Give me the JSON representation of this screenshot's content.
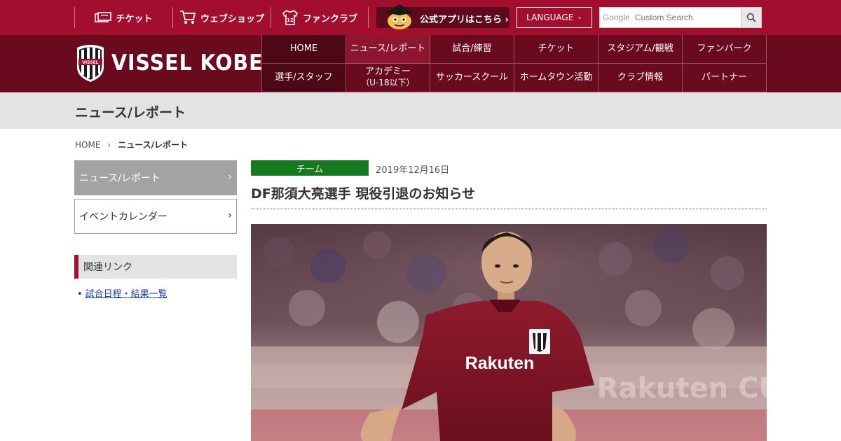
{
  "colors": {
    "brand": "#a30d2e",
    "header_dark": "#6a0a1e",
    "category_green": "#137a1e",
    "link_blue": "#1a3ea0"
  },
  "utility": {
    "ticket_label": "チケット",
    "shop_label": "ウェブショップ",
    "fanclub_label": "ファンクラブ",
    "app_label": "公式アプリはこちら",
    "language_label": "LANGUAGE",
    "search_placeholder": "Custom Search",
    "search_brand": "Google"
  },
  "logo": {
    "text": "VISSEL KOBE",
    "emblem_text": "VISSEL"
  },
  "nav": {
    "items": [
      {
        "label": "HOME"
      },
      {
        "label": "ニュース/レポート"
      },
      {
        "label": "試合/練習"
      },
      {
        "label": "チケット"
      },
      {
        "label": "スタジアム/観戦"
      },
      {
        "label": "ファンパーク"
      },
      {
        "label": "選手/スタッフ"
      },
      {
        "label": "アカデミー",
        "sub": "（U-18以下）"
      },
      {
        "label": "サッカースクール"
      },
      {
        "label": "ホームタウン活動"
      },
      {
        "label": "クラブ情報"
      },
      {
        "label": "パートナー"
      }
    ]
  },
  "page_title": "ニュース/レポート",
  "breadcrumb": {
    "home": "HOME",
    "current": "ニュース/レポート"
  },
  "sidebar": {
    "items": [
      {
        "label": "ニュース/レポート"
      },
      {
        "label": "イベントカレンダー"
      }
    ],
    "related_heading": "関連リンク",
    "related_links": [
      {
        "label": "試合日程・結果一覧"
      }
    ]
  },
  "article": {
    "category": "チーム",
    "date": "2019年12月16日",
    "title": "DF那須大亮選手 現役引退のお知らせ",
    "photo": {
      "jersey_sponsor": "Rakuten",
      "banner_text": "Rakuten CUP"
    }
  }
}
